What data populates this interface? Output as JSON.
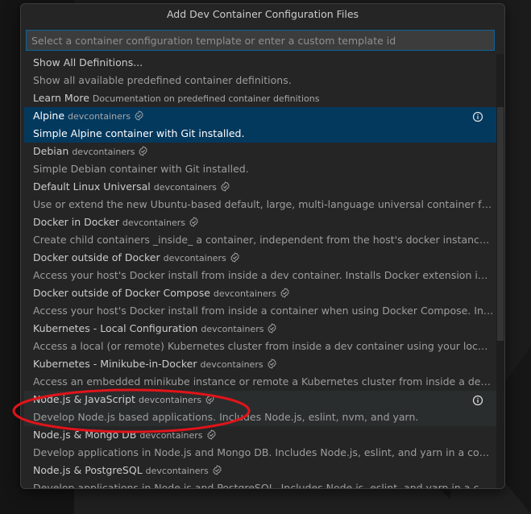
{
  "dialog": {
    "title": "Add Dev Container Configuration Files",
    "search_placeholder": "Select a container configuration template or enter a custom template id",
    "search_value": ""
  },
  "items": [
    {
      "label": "Show All Definitions...",
      "description": "Show all available predefined container definitions."
    },
    {
      "label": "Learn More",
      "meta": "Documentation on predefined container definitions"
    },
    {
      "label": "Alpine",
      "meta": "devcontainers",
      "description": "Simple Alpine container with Git installed.",
      "selected": true
    },
    {
      "label": "Debian",
      "meta": "devcontainers",
      "description": "Simple Debian container with Git installed."
    },
    {
      "label": "Default Linux Universal",
      "meta": "devcontainers",
      "description": "Use or extend the new Ubuntu-based default, large, multi-language universal container for GitHu..."
    },
    {
      "label": "Docker in Docker",
      "meta": "devcontainers",
      "description": "Create child containers _inside_ a container, independent from the host's docker instance. Installs ..."
    },
    {
      "label": "Docker outside of Docker",
      "meta": "devcontainers",
      "description": "Access your host's Docker install from inside a dev container. Installs Docker extension in the cont..."
    },
    {
      "label": "Docker outside of Docker Compose",
      "meta": "devcontainers",
      "description": "Access your host's Docker install from inside a container when using Docker Compose. Installs Do..."
    },
    {
      "label": "Kubernetes - Local Configuration",
      "meta": "devcontainers",
      "description": "Access a local (or remote) Kubernetes cluster from inside a dev container using your local config. ..."
    },
    {
      "label": "Kubernetes - Minikube-in-Docker",
      "meta": "devcontainers",
      "description": "Access an embedded minikube instance or remote a Kubernetes cluster from inside a dev contain..."
    },
    {
      "label": "Node.js & JavaScript",
      "meta": "devcontainers",
      "description": "Develop Node.js based applications. Includes Node.js, eslint, nvm, and yarn.",
      "hover": true
    },
    {
      "label": "Node.js & Mongo DB",
      "meta": "devcontainers",
      "description": "Develop applications in Node.js and Mongo DB. Includes Node.js, eslint, and yarn in a container li..."
    },
    {
      "label": "Node.js & PostgreSQL",
      "meta": "devcontainers",
      "description": "Develop applications in Node.js and PostgreSQL. Includes Node.js, eslint, and yarn in a container l..."
    }
  ],
  "colors": {
    "selected_bg": "#04395e",
    "accent_border": "#0e639c",
    "annotation_red": "#e0141a"
  },
  "icons": {
    "verified": "verified-badge-icon",
    "info": "info-icon"
  }
}
